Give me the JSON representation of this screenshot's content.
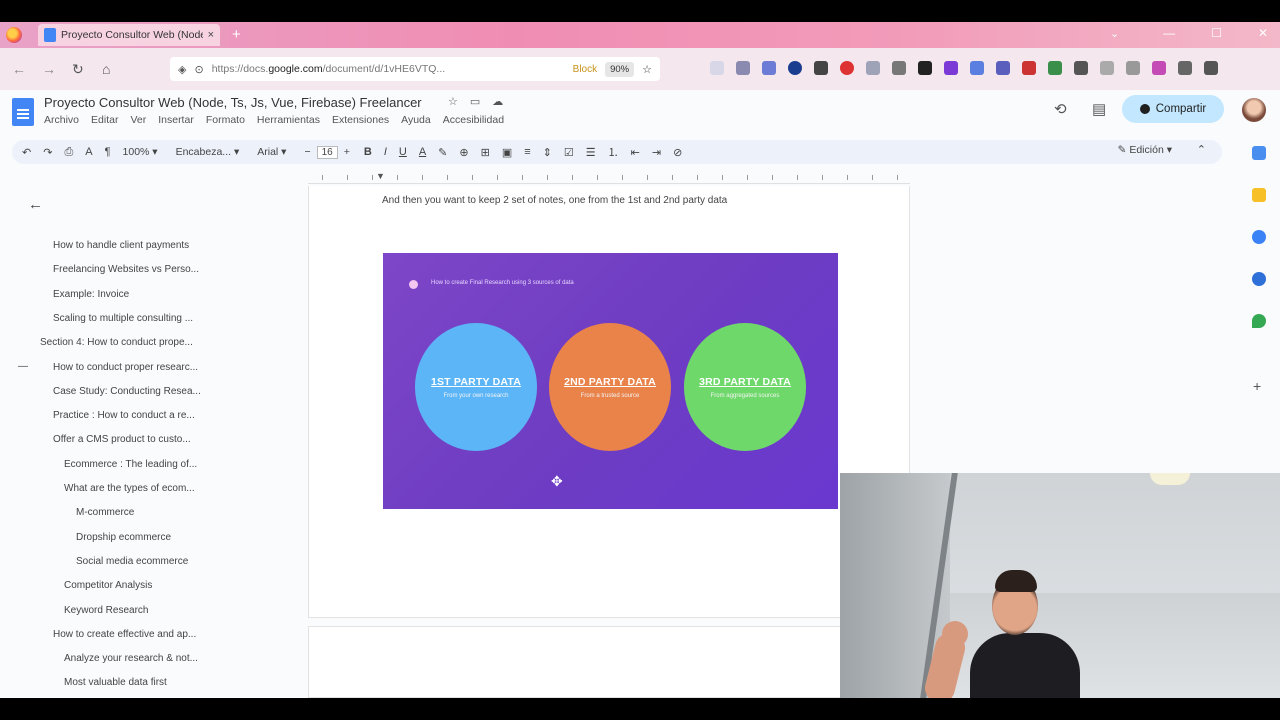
{
  "browser": {
    "tab_title": "Proyecto Consultor Web (Node",
    "tab_close": "×",
    "new_tab": "+",
    "url_prefix": "https://docs.",
    "url_domain": "google.com",
    "url_rest": "/document/d/1vHE6VTQ...",
    "url_badge": "Block",
    "zoom": "90%",
    "win_minimize": "—",
    "win_maximize": "☐",
    "win_close": "✕",
    "tab_list_icon": "⌄"
  },
  "docs": {
    "title": "Proyecto Consultor Web (Node, Ts, Js, Vue, Firebase) Freelancer",
    "menu": [
      "Archivo",
      "Editar",
      "Ver",
      "Insertar",
      "Formato",
      "Herramientas",
      "Extensiones",
      "Ayuda",
      "Accesibilidad"
    ],
    "share_label": "Compartir",
    "history_icon": "⟲",
    "comments_icon": "▤",
    "star_icon": "☆",
    "move_icon": "▭",
    "cloud_icon": "☁"
  },
  "toolbar": {
    "undo": "↶",
    "redo": "↷",
    "print": "⎙",
    "spell": "A",
    "paint": "¶",
    "zoom": "100%",
    "style": "Encabeza...",
    "font": "Arial",
    "minus": "−",
    "font_size": "16",
    "plus": "+",
    "bold": "B",
    "italic": "I",
    "underline": "U",
    "text_color": "A",
    "highlight": "✎",
    "link": "⊕",
    "comment": "⊞",
    "image": "▣",
    "align": "≡",
    "spacing": "⇕",
    "checklist": "☑",
    "bullets": "☰",
    "numbering": "⒈",
    "indent_less": "⇤",
    "indent_more": "⇥",
    "clear": "⊘",
    "edit_mode": "Edición",
    "collapse": "⌃"
  },
  "outline": {
    "back": "←",
    "collapse_dash": "—",
    "items": [
      {
        "label": "How to handle client payments",
        "level": 1
      },
      {
        "label": "Freelancing Websites vs Perso...",
        "level": 1
      },
      {
        "label": "Example: Invoice",
        "level": 1
      },
      {
        "label": "Scaling to multiple consulting ...",
        "level": 1
      },
      {
        "label": "Section 4: How to conduct prope...",
        "level": 0
      },
      {
        "label": "How to conduct proper researc...",
        "level": 1
      },
      {
        "label": "Case Study: Conducting Resea...",
        "level": 1
      },
      {
        "label": "Practice : How to conduct a re...",
        "level": 1
      },
      {
        "label": "Offer a CMS product to custo...",
        "level": 1
      },
      {
        "label": "Ecommerce : The leading of...",
        "level": 2
      },
      {
        "label": "What are the types of ecom...",
        "level": 2
      },
      {
        "label": "M-commerce",
        "level": 3
      },
      {
        "label": "Dropship ecommerce",
        "level": 3
      },
      {
        "label": "Social media ecommerce",
        "level": 3
      },
      {
        "label": "Competitor Analysis",
        "level": 2
      },
      {
        "label": "Keyword Research",
        "level": 2
      },
      {
        "label": "How to create effective and ap...",
        "level": 1
      },
      {
        "label": "Analyze your research & not...",
        "level": 2
      },
      {
        "label": "Most valuable data first",
        "level": 2
      }
    ]
  },
  "document": {
    "paragraph": "And then you want to keep 2 set of notes, one from the 1st and 2nd party data",
    "slide": {
      "heading": "How to create Final Research using 3 sources of data",
      "circles": [
        {
          "title": "1ST PARTY DATA",
          "subtitle": "From your own research",
          "color": "#5cb5f7"
        },
        {
          "title": "2ND PARTY DATA",
          "subtitle": "From a trusted source",
          "color": "#e9834a"
        },
        {
          "title": "3RD PARTY DATA",
          "subtitle": "From aggregated sources",
          "color": "#6fd86b"
        }
      ],
      "cursor": "✥"
    }
  },
  "colors": {
    "share_bg": "#c2e7ff",
    "slide_bg": "#7e46c8",
    "docs_blue": "#4285f4"
  }
}
